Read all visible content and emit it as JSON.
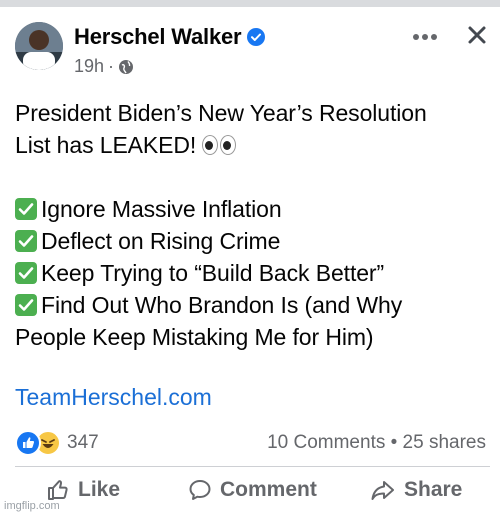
{
  "post": {
    "author": "Herschel Walker",
    "time": "19h",
    "separator": "·",
    "text_lines": [
      "President Biden’s New Year’s Resolution",
      "List has LEAKED!"
    ],
    "list": [
      "Ignore Massive Inflation",
      "Deflect on Rising Crime",
      "Keep Trying to “Build Back Better”",
      "Find Out Who Brandon Is (and Why",
      "People Keep Mistaking Me for Him)"
    ],
    "link": "TeamHerschel.com"
  },
  "stats": {
    "reactions_count": "347",
    "comments_shares": "10 Comments • 25 shares"
  },
  "actions": {
    "like": "Like",
    "comment": "Comment",
    "share": "Share"
  },
  "icons": {
    "verified": "verified-badge-icon",
    "globe": "globe-icon",
    "more": "more-horizontal-icon",
    "close": "close-icon",
    "like": "thumbs-up-icon",
    "comment": "comment-bubble-icon",
    "share": "share-arrow-icon",
    "check": "green-check-emoji",
    "eyes": "eyes-emoji"
  },
  "watermark": "imgflip.com",
  "colors": {
    "link": "#1b6fd6",
    "meta": "#65676b",
    "check": "#4caf50",
    "like_blue": "#1877f2"
  }
}
